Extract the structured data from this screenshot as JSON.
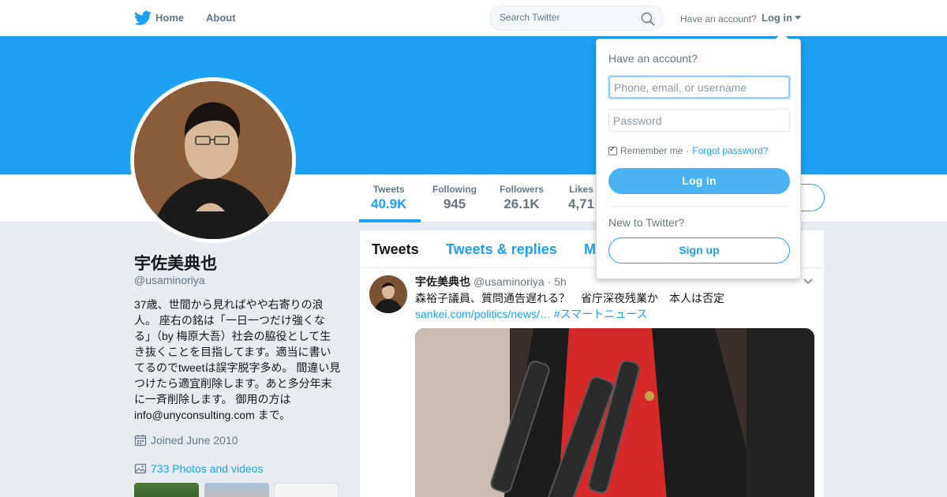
{
  "nav": {
    "home": "Home",
    "about": "About",
    "search_placeholder": "Search Twitter",
    "have_account": "Have an account?",
    "login": "Log in"
  },
  "stats": [
    {
      "label": "Tweets",
      "value": "40.9K",
      "active": true
    },
    {
      "label": "Following",
      "value": "945"
    },
    {
      "label": "Followers",
      "value": "26.1K"
    },
    {
      "label": "Likes",
      "value": "4,71"
    }
  ],
  "profile": {
    "name": "宇佐美典也",
    "handle": "@usaminoriya",
    "bio": "37歳、世間から見ればやや右寄りの浪人。 座右の銘は「一日一つだけ強くなる」（by 梅原大吾）社会の脇役として生き抜くことを目指してます。適当に書いてるのでtweetは誤字脱字多め。 間違い見つけたら適宜削除します。あと多分年末に一斉削除します。 御用の方は info@unyconsulting.com まで。",
    "joined": "Joined June 2010",
    "photos": "733 Photos and videos"
  },
  "tabs": [
    "Tweets",
    "Tweets & replies",
    "M"
  ],
  "tweet": {
    "name": "宇佐美典也",
    "handle": "@usaminoriya",
    "time": "· 5h",
    "text": "森裕子議員、質問通告遅れる？　省庁深夜残業か　本人は否定",
    "link": "sankei.com/politics/news/…",
    "hashtag": "#スマートニュース"
  },
  "login_dropdown": {
    "title": "Have an account?",
    "username_placeholder": "Phone, email, or username",
    "password_placeholder": "Password",
    "remember": "Remember me",
    "separator": "·",
    "forgot": "Forgot password?",
    "login_button": "Log in",
    "new_to_twitter": "New to Twitter?",
    "signup_button": "Sign up"
  },
  "colors": {
    "brand_blue": "#1da1f2",
    "login_button": "#4ab3f4"
  }
}
